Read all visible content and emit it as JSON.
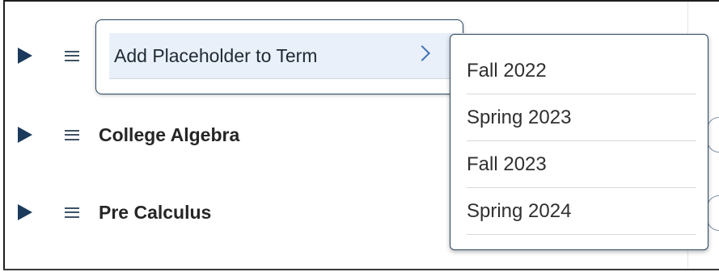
{
  "rows": [
    {
      "label": "Add Placeholder to Term"
    },
    {
      "label": "College Algebra"
    },
    {
      "label": "Pre Calculus"
    }
  ],
  "context_menu": {
    "item_label": "Add Placeholder to Term",
    "item_icon": "chevron-right-icon"
  },
  "submenu": {
    "items": [
      {
        "label": "Fall 2022"
      },
      {
        "label": "Spring 2023"
      },
      {
        "label": "Fall 2023"
      },
      {
        "label": "Spring 2024"
      }
    ]
  },
  "icons": {
    "expand": "triangle-right-icon",
    "drag": "drag-handle-icon"
  },
  "colors": {
    "accent": "#1b3a5c",
    "menu_highlight": "#e9f0f9",
    "chevron": "#3d6fb6"
  }
}
